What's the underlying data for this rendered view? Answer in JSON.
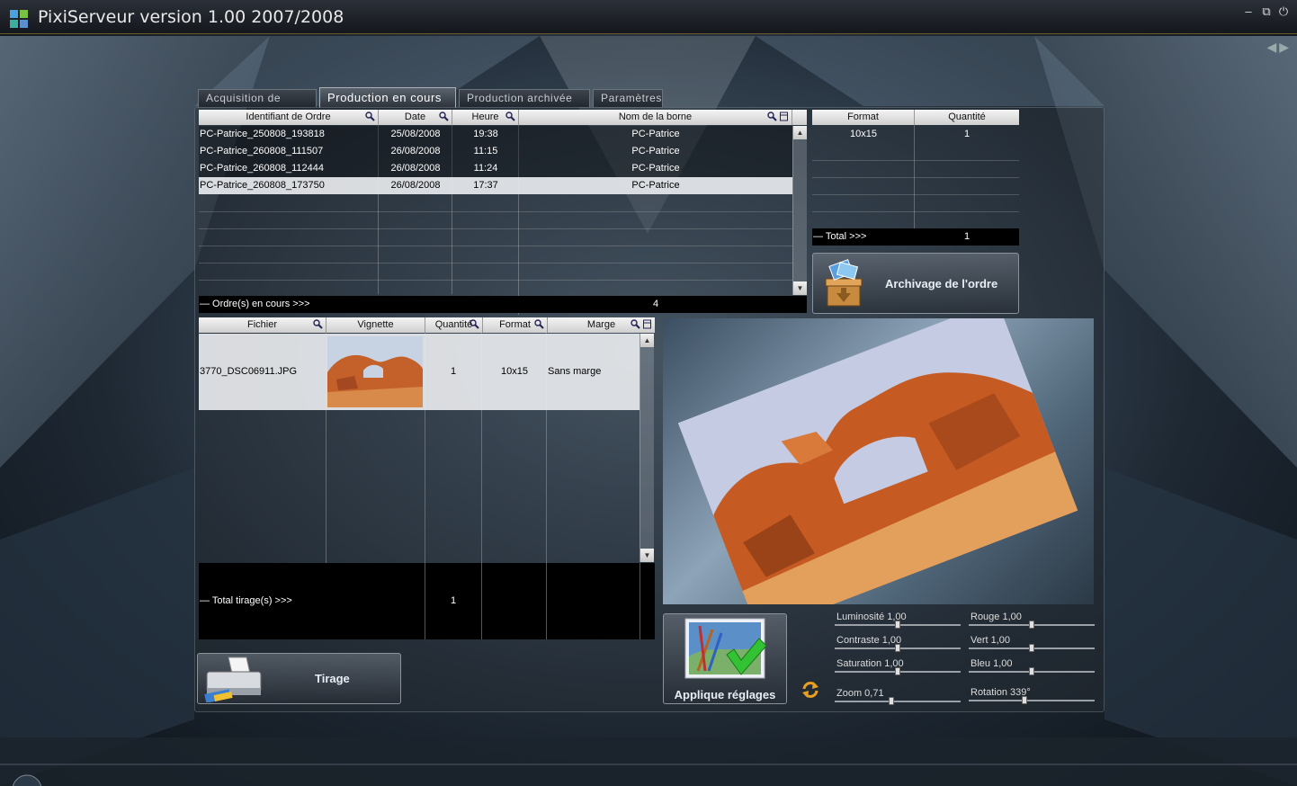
{
  "window": {
    "title": "PixiServeur version 1.00 2007/2008",
    "controls": {
      "minimize": "–",
      "restore": "⧉",
      "close": "⏻"
    }
  },
  "nav": {
    "prev": "◀",
    "next": "▶"
  },
  "tabs": [
    {
      "label": "Acquisition de photo",
      "active": false
    },
    {
      "label": "Production en cours",
      "active": true
    },
    {
      "label": "Production archivée",
      "active": false
    },
    {
      "label": "Paramètres",
      "active": false
    }
  ],
  "orders": {
    "columns": [
      "Identifiant de Ordre",
      "Date",
      "Heure",
      "Nom de la borne"
    ],
    "rows": [
      {
        "id": "PC-Patrice_250808_193818",
        "date": "25/08/2008",
        "time": "19:38",
        "kiosk": "PC-Patrice",
        "selected": false
      },
      {
        "id": "PC-Patrice_260808_111507",
        "date": "26/08/2008",
        "time": "11:15",
        "kiosk": "PC-Patrice",
        "selected": false
      },
      {
        "id": "PC-Patrice_260808_112444",
        "date": "26/08/2008",
        "time": "11:24",
        "kiosk": "PC-Patrice",
        "selected": false
      },
      {
        "id": "PC-Patrice_260808_173750",
        "date": "26/08/2008",
        "time": "17:37",
        "kiosk": "PC-Patrice",
        "selected": true
      }
    ],
    "footer_label": "— Ordre(s) en cours >>>",
    "footer_value": "4"
  },
  "formats": {
    "columns": [
      "Format",
      "Quantité"
    ],
    "rows": [
      {
        "format": "10x15",
        "qty": "1"
      }
    ],
    "total_label": "— Total >>>",
    "total_value": "1"
  },
  "archive_button": {
    "label": "Archivage de l'ordre"
  },
  "files": {
    "columns": [
      "Fichier",
      "Vignette",
      "Quantité",
      "Format",
      "Marge"
    ],
    "rows": [
      {
        "file": "3770_DSC06911.JPG",
        "qty": "1",
        "format": "10x15",
        "margin": "Sans marge"
      }
    ],
    "total_label": "— Total tirage(s) >>>",
    "total_value": "1"
  },
  "print_button": {
    "label": "Tirage"
  },
  "apply_button": {
    "label": "Applique réglages"
  },
  "adjustments": {
    "brightness": {
      "label": "Luminosité 1,00",
      "level": 0.5
    },
    "contrast": {
      "label": "Contraste 1,00",
      "level": 0.5
    },
    "saturation": {
      "label": "Saturation 1,00",
      "level": 0.5
    },
    "zoom": {
      "label": "Zoom 0,71",
      "level": 0.45
    },
    "red": {
      "label": "Rouge 1,00",
      "level": 0.5
    },
    "green": {
      "label": "Vert 1,00",
      "level": 0.5
    },
    "blue": {
      "label": "Bleu 1,00",
      "level": 0.5
    },
    "rotation": {
      "label": "Rotation 339°",
      "level": 0.44
    }
  },
  "colors": {
    "accent": "#6a5a2a",
    "selection": "#e6e8ec",
    "header": "#e6e6e6"
  }
}
